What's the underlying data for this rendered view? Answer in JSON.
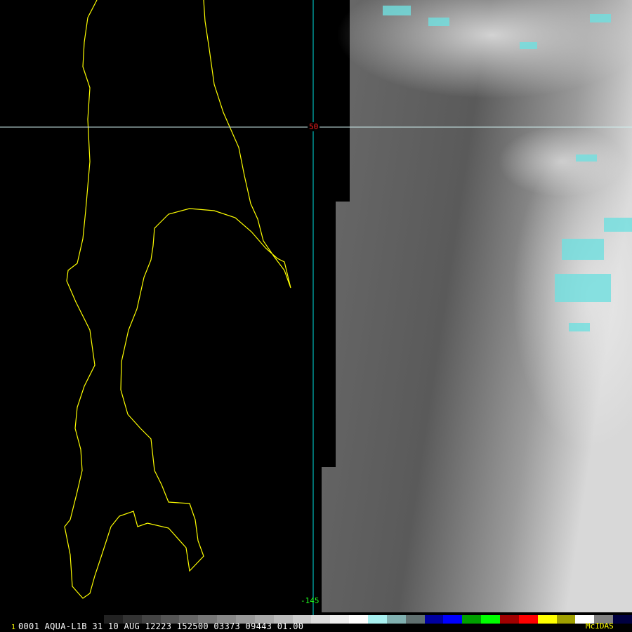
{
  "map": {
    "latitude_label": "50",
    "longitude_label": "-145",
    "coastline_color": "#ffff00",
    "gridline_color": "#00e0e0"
  },
  "status_bar": {
    "frame_number": "1",
    "text": "0001 AQUA-L1B  31 10 AUG 12223 152500 03373 09443 01.00",
    "brand": "McIDAS"
  },
  "colorbar": [
    "#222",
    "#333",
    "#444",
    "#555",
    "#666",
    "#777",
    "#888",
    "#999",
    "#aaa",
    "#bbb",
    "#ccc",
    "#ddd",
    "#eee",
    "#fff",
    "#a8f0f0",
    "#80b0b0",
    "#607070",
    "#0000a0",
    "#0000ff",
    "#00a000",
    "#00ff00",
    "#a00000",
    "#ff0000",
    "#ffff00",
    "#a0a000",
    "#ffffff",
    "#808080",
    "#000040"
  ]
}
